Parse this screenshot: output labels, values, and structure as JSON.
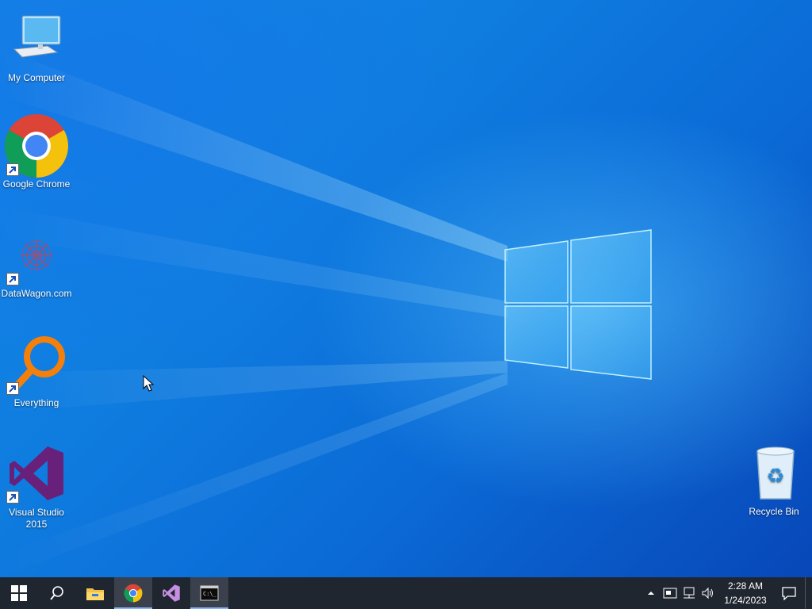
{
  "desktop": {
    "icons": [
      {
        "name": "my-computer",
        "label": "My Computer"
      },
      {
        "name": "google-chrome",
        "label": "Google Chrome"
      },
      {
        "name": "datawagon",
        "label": "DataWagon.com"
      },
      {
        "name": "everything",
        "label": "Everything"
      },
      {
        "name": "visual-studio",
        "label": "Visual Studio 2015"
      },
      {
        "name": "recycle-bin",
        "label": "Recycle Bin"
      }
    ]
  },
  "taskbar": {
    "buttons": [
      {
        "name": "start-button",
        "icon": "windows-logo-icon"
      },
      {
        "name": "search-button",
        "icon": "search-icon"
      },
      {
        "name": "file-explorer-button",
        "icon": "folder-icon"
      },
      {
        "name": "chrome-taskbar-button",
        "icon": "chrome-icon",
        "active": true
      },
      {
        "name": "visual-studio-taskbar-button",
        "icon": "visual-studio-icon"
      },
      {
        "name": "cmd-taskbar-button",
        "icon": "cmd-icon",
        "active": true
      }
    ],
    "tray": {
      "icons": [
        "chevron-up-icon",
        "network-adapter-icon",
        "network-icon",
        "volume-icon"
      ],
      "time": "2:28 AM",
      "date": "1/24/2023"
    }
  },
  "colors": {
    "taskbar_bg": "#202630",
    "wallpaper_blue": "#0b6ad6",
    "vs_purple": "#68217a",
    "everything_orange": "#f47f0a"
  }
}
